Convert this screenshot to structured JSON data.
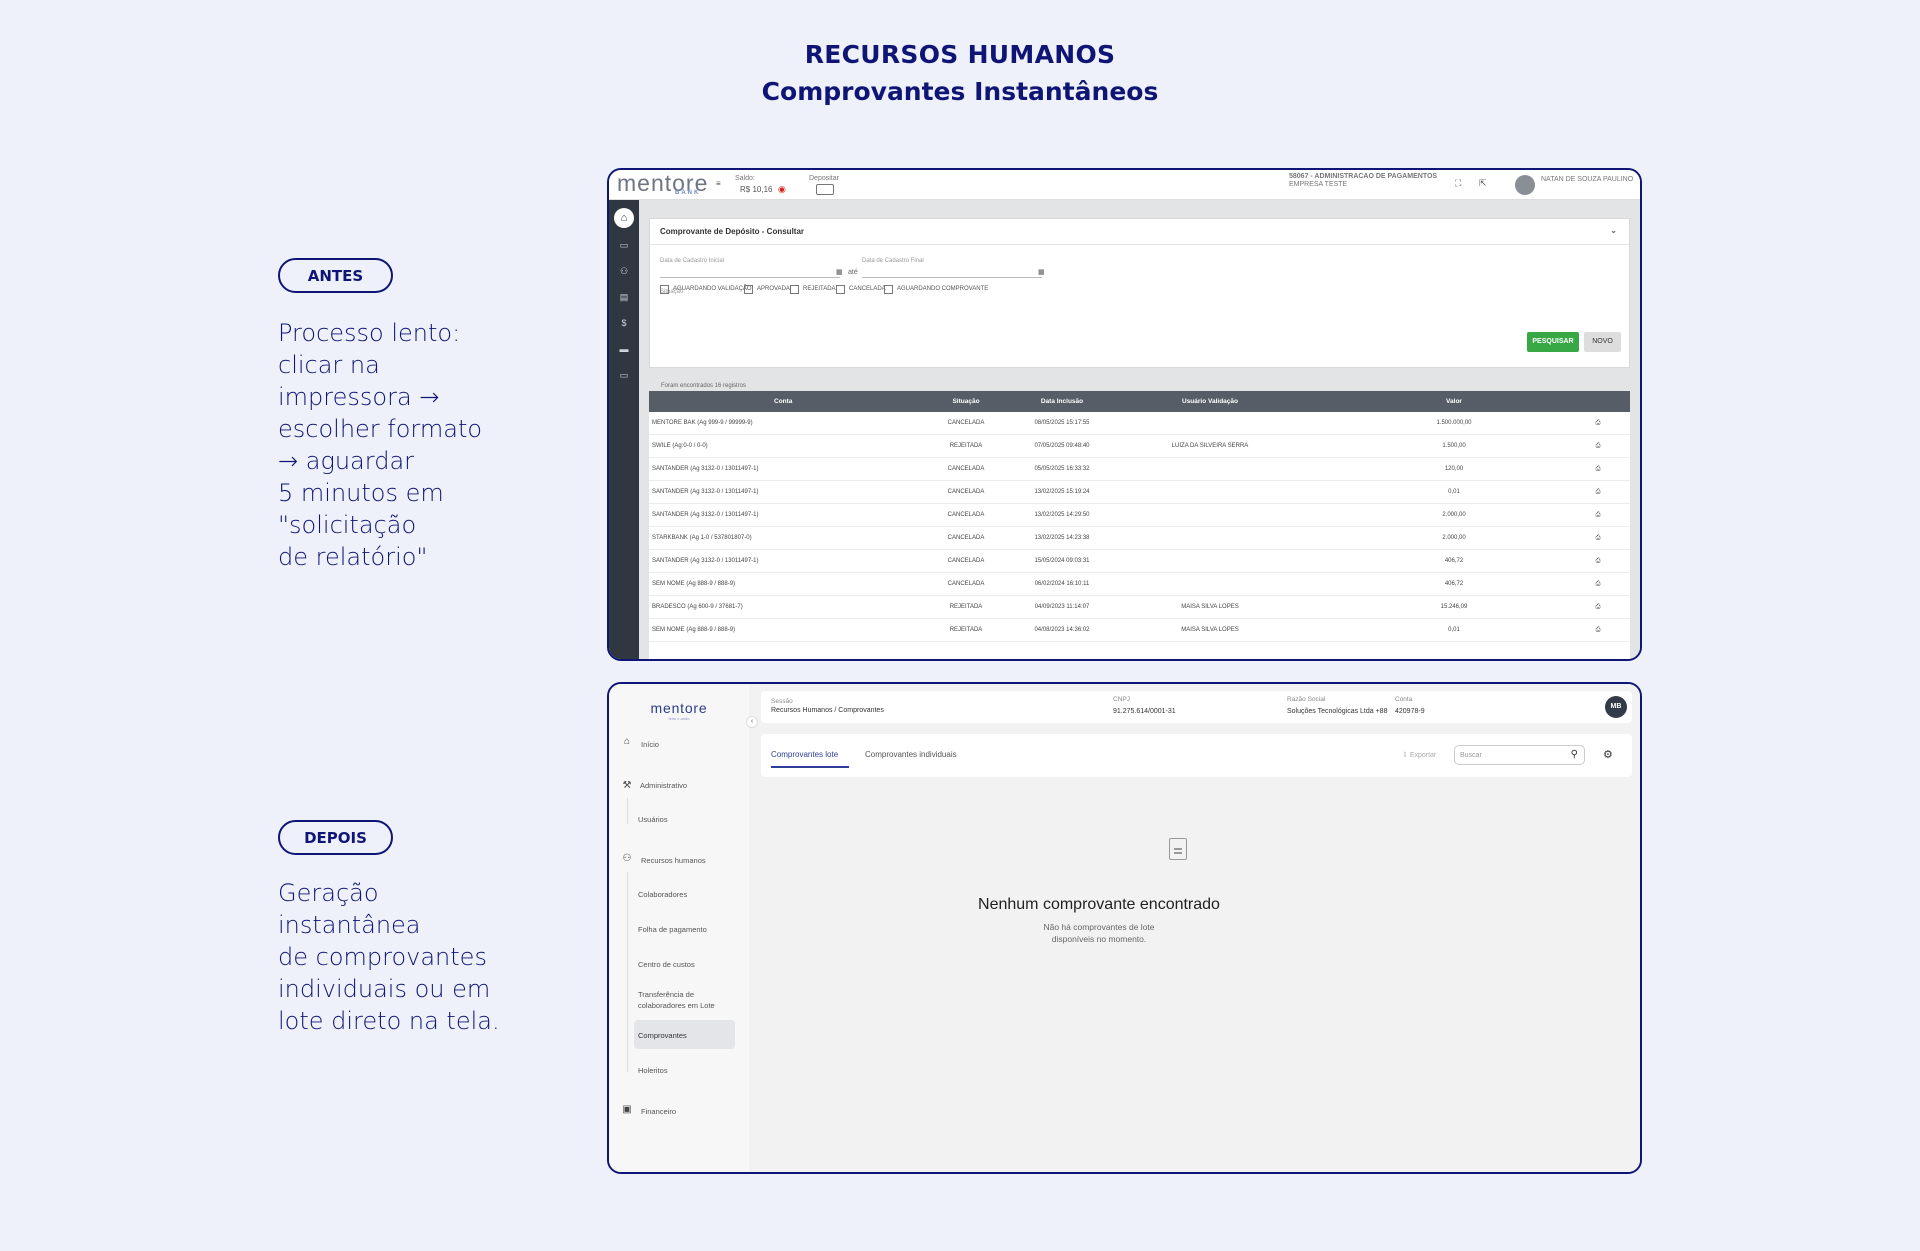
{
  "header": {
    "title": "RECURSOS HUMANOS",
    "subtitle": "Comprovantes Instantâneos"
  },
  "before": {
    "label": "ANTES",
    "description": "Processo lento:\nclicar na\nimpressora →\nescolher formato\n→ aguardar\n5 minutos em\n\"solicitação\nde relatório\"",
    "app": {
      "logo": "mentore",
      "logo_sub": "BANK",
      "saldo_label": "Saldo:",
      "saldo_value": "R$ 10,16",
      "depositar_label": "Depositar",
      "company_line1": "58067 - ADMINISTRACAO DE PAGAMENTOS",
      "company_line2": "EMPRESA TESTE",
      "user_name": "NATAN DE SOUZA PAULINO",
      "panel_title": "Comprovante de Depósito - Consultar",
      "date_start_label": "Data de Cadastro Inicial",
      "date_end_label": "Data de Cadastro Final",
      "ate": "até",
      "situacao_label": "Situação",
      "checkboxes": [
        "AGUARDANDO VALIDAÇÃO",
        "APROVADA",
        "REJEITADA",
        "CANCELADA",
        "AGUARDANDO COMPROVANTE"
      ],
      "search_button": "PESQUISAR",
      "new_button": "NOVO",
      "found_text": "Foram encontrados 16 registros",
      "columns": [
        "Conta",
        "Situação",
        "Data Inclusão",
        "Usuário Validação",
        "Valor"
      ],
      "rows": [
        {
          "conta": "MENTORE BAK (Ag 999-9 / 99999-9)",
          "situacao": "CANCELADA",
          "data": "08/05/2025 15:17:55",
          "usuario": "",
          "valor": "1.500.000,00"
        },
        {
          "conta": "SWILE (Ag:0-0 / 0-0)",
          "situacao": "REJEITADA",
          "data": "07/05/2025 09:48:40",
          "usuario": "LUIZA DA SILVEIRA SERRA",
          "valor": "1.500,00"
        },
        {
          "conta": "SANTANDER (Ag 3132-0 / 13011497-1)",
          "situacao": "CANCELADA",
          "data": "05/05/2025 16:33:32",
          "usuario": "",
          "valor": "120,00"
        },
        {
          "conta": "SANTANDER (Ag 3132-0 / 13011497-1)",
          "situacao": "CANCELADA",
          "data": "13/02/2025 15:19:24",
          "usuario": "",
          "valor": "0,01"
        },
        {
          "conta": "SANTANDER (Ag 3132-0 / 13011497-1)",
          "situacao": "CANCELADA",
          "data": "13/02/2025 14:29:50",
          "usuario": "",
          "valor": "2.000,00"
        },
        {
          "conta": "STARKBANK (Ag 1-0 / 537801807-0)",
          "situacao": "CANCELADA",
          "data": "13/02/2025 14:23:38",
          "usuario": "",
          "valor": "2.000,00"
        },
        {
          "conta": "SANTANDER (Ag 3132-0 / 13011497-1)",
          "situacao": "CANCELADA",
          "data": "15/05/2024 09:03:31",
          "usuario": "",
          "valor": "406,72"
        },
        {
          "conta": "SEM NOME (Ag 888-9 / 888-9)",
          "situacao": "CANCELADA",
          "data": "06/02/2024 16:10:11",
          "usuario": "",
          "valor": "406,72"
        },
        {
          "conta": "BRADESCO (Ag 600-9 / 37681-7)",
          "situacao": "REJEITADA",
          "data": "04/09/2023 11:14:07",
          "usuario": "MAISA SILVA LOPES",
          "valor": "15.246,09"
        },
        {
          "conta": "SEM NOME (Ag 888-9 / 888-9)",
          "situacao": "REJEITADA",
          "data": "04/08/2023 14:36:02",
          "usuario": "MAISA SILVA LOPES",
          "valor": "0,01"
        }
      ]
    }
  },
  "after": {
    "label": "DEPOIS",
    "description": "Geração\ninstantânea\nde comprovantes\nindividuais ou em\nlote direto na tela.",
    "app": {
      "logo": "mentore",
      "logo_sub": "feito e ando",
      "nav": {
        "inicio": "Início",
        "administrativo": "Administrativo",
        "usuarios": "Usuários",
        "rh": "Recursos humanos",
        "colaboradores": "Colaboradores",
        "folha": "Folha de pagamento",
        "centro": "Centro de custos",
        "transferencia_1": "Transferência de",
        "transferencia_2": "colaboradores em Lote",
        "comprovantes": "Comprovantes",
        "holeritos": "Holeritos",
        "financeiro": "Financeiro"
      },
      "sessao_label": "Sessão",
      "sessao_value": "Recursos Humanos / Comprovantes",
      "cnpj_label": "CNPJ",
      "cnpj_value": "91.275.614/0001-31",
      "razao_label": "Razão Social",
      "razao_value": "Soluções Tecnológicas Ltda +88",
      "conta_label": "Conta",
      "conta_value": "420978-9",
      "avatar": "MB",
      "tab_lote": "Comprovantes lote",
      "tab_individuais": "Comprovantes individuais",
      "export": "Exportar",
      "search_placeholder": "Buscar",
      "empty_title": "Nenhum comprovante encontrado",
      "empty_sub": "Não há comprovantes de lote disponíveis no momento."
    }
  }
}
